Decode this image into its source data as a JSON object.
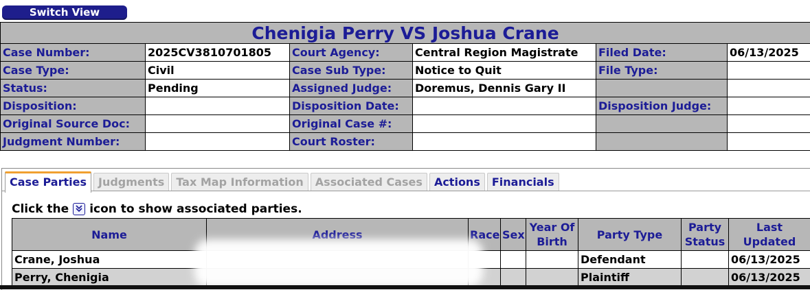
{
  "switch_view_label": "Switch View",
  "case": {
    "title": "Chenigia Perry VS Joshua Crane",
    "case_number_label": "Case Number:",
    "case_number": "2025CV3810701805",
    "court_agency_label": "Court Agency:",
    "court_agency": "Central Region Magistrate",
    "filed_date_label": "Filed Date:",
    "filed_date": "06/13/2025",
    "case_type_label": "Case Type:",
    "case_type": "Civil",
    "case_sub_type_label": "Case Sub Type:",
    "case_sub_type": "Notice to Quit",
    "file_type_label": "File Type:",
    "file_type": "",
    "status_label": "Status:",
    "status": "Pending",
    "assigned_judge_label": "Assigned Judge:",
    "assigned_judge": "Doremus, Dennis Gary II",
    "disposition_label": "Disposition:",
    "disposition": "",
    "disposition_date_label": "Disposition Date:",
    "disposition_date": "",
    "disposition_judge_label": "Disposition Judge:",
    "disposition_judge": "",
    "original_source_doc_label": "Original Source Doc:",
    "original_source_doc": "",
    "original_case_label": "Original Case #:",
    "original_case": "",
    "judgment_number_label": "Judgment Number:",
    "judgment_number": "",
    "court_roster_label": "Court Roster:",
    "court_roster": ""
  },
  "tabs": [
    {
      "label": "Case Parties",
      "state": "active"
    },
    {
      "label": "Judgments",
      "state": "disabled"
    },
    {
      "label": "Tax Map Information",
      "state": "disabled"
    },
    {
      "label": "Associated Cases",
      "state": "disabled"
    },
    {
      "label": "Actions",
      "state": "enabled"
    },
    {
      "label": "Financials",
      "state": "enabled"
    }
  ],
  "hint": {
    "before": "Click the",
    "icon": "expand-icon",
    "after": "icon to show associated parties."
  },
  "parties": {
    "headers": {
      "name": "Name",
      "address": "Address",
      "race": "Race",
      "sex": "Sex",
      "year_of_birth": "Year Of Birth",
      "party_type": "Party Type",
      "party_status": "Party Status",
      "last_updated": "Last Updated"
    },
    "rows": [
      {
        "name": "Crane, Joshua",
        "address": "",
        "race": "",
        "sex": "",
        "year_of_birth": "",
        "party_type": "Defendant",
        "party_status": "",
        "last_updated": "06/13/2025"
      },
      {
        "name": "Perry, Chenigia",
        "address": "",
        "race": "",
        "sex": "",
        "year_of_birth": "",
        "party_type": "Plaintiff",
        "party_status": "",
        "last_updated": "06/13/2025"
      }
    ]
  },
  "colors": {
    "label_text": "#1c1c96",
    "label_bg": "#b7b7b7",
    "button_bg": "#1e1e8c",
    "active_tab_accent": "#f0a030"
  }
}
